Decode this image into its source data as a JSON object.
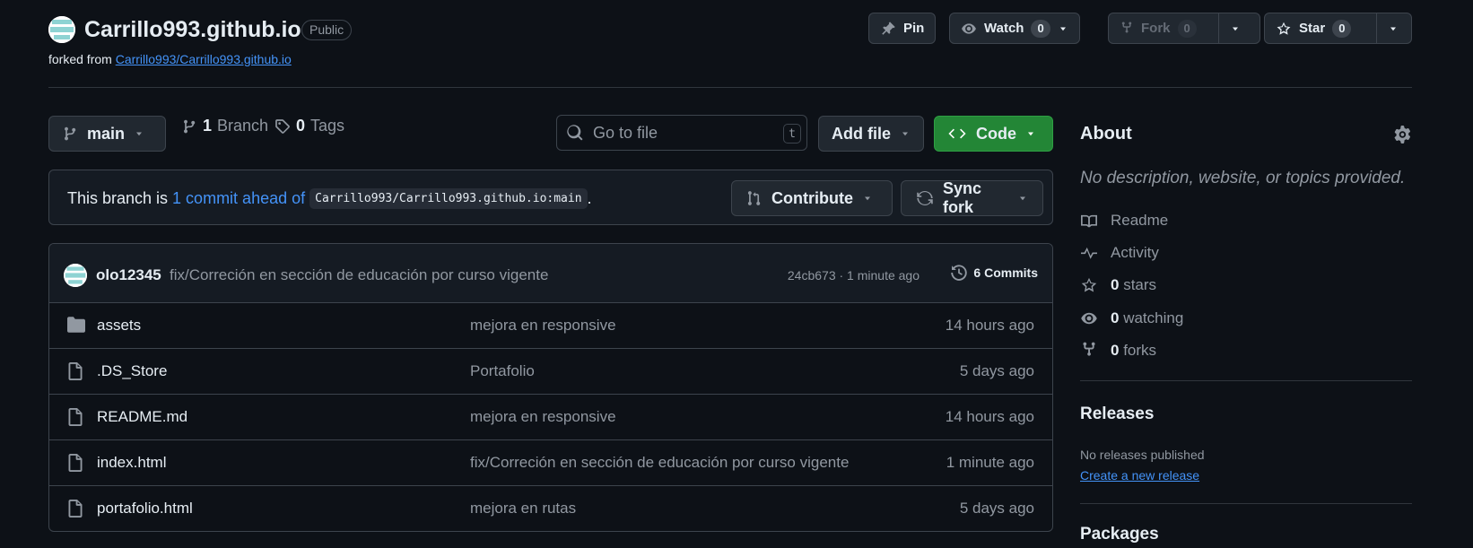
{
  "repo": {
    "name": "Carrillo993.github.io",
    "visibility": "Public",
    "forked_from_prefix": "forked from",
    "forked_from": "Carrillo993/Carrillo993.github.io"
  },
  "header_actions": {
    "pin": "Pin",
    "watch": "Watch",
    "watch_count": "0",
    "fork": "Fork",
    "fork_count": "0",
    "star": "Star",
    "star_count": "0"
  },
  "toolbar": {
    "branch": "main",
    "branch_count": "1",
    "branch_label": "Branch",
    "tags_count": "0",
    "tags_label": "Tags",
    "goto_placeholder": "Go to file",
    "goto_shortcut": "t",
    "add_file": "Add file",
    "code": "Code"
  },
  "ahead": {
    "prefix": "This branch is",
    "link": "1 commit ahead of",
    "ref": "Carrillo993/Carrillo993.github.io:main",
    "suffix": ".",
    "contribute": "Contribute",
    "sync_fork": "Sync fork"
  },
  "latest_commit": {
    "author": "olo12345",
    "message": "fix/Correción en sección de educación por curso vigente",
    "meta": "24cb673 · 1 minute ago",
    "commits": "6 Commits"
  },
  "files": [
    {
      "type": "folder",
      "name": "assets",
      "message": "mejora en responsive",
      "time": "14 hours ago"
    },
    {
      "type": "file",
      "name": ".DS_Store",
      "message": "Portafolio",
      "time": "5 days ago"
    },
    {
      "type": "file",
      "name": "README.md",
      "message": "mejora en responsive",
      "time": "14 hours ago"
    },
    {
      "type": "file",
      "name": "index.html",
      "message": "fix/Correción en sección de educación por curso vigente",
      "time": "1 minute ago"
    },
    {
      "type": "file",
      "name": "portafolio.html",
      "message": "mejora en rutas",
      "time": "5 days ago"
    }
  ],
  "about": {
    "title": "About",
    "description": "No description, website, or topics provided.",
    "readme": "Readme",
    "activity": "Activity",
    "stars_count": "0",
    "stars_label": "stars",
    "watching_count": "0",
    "watching_label": "watching",
    "forks_count": "0",
    "forks_label": "forks"
  },
  "releases": {
    "title": "Releases",
    "empty": "No releases published",
    "create": "Create a new release"
  },
  "packages": {
    "title": "Packages"
  },
  "colors": {
    "background": "#0d1117",
    "link": "#4493f8",
    "code_button": "#238636",
    "border": "#3d444d"
  }
}
